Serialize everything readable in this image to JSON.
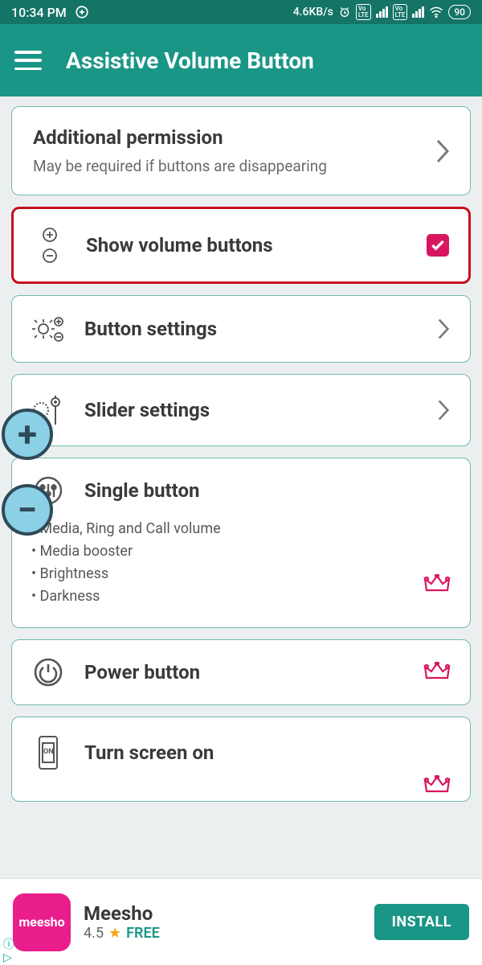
{
  "status": {
    "time": "10:34 PM",
    "speed": "4.6KB/s",
    "battery": "90"
  },
  "appbar": {
    "title": "Assistive Volume Button"
  },
  "cards": {
    "additional": {
      "title": "Additional permission",
      "sub": "May be required if buttons are disappearing"
    },
    "show": {
      "title": "Show volume buttons"
    },
    "button_settings": {
      "title": "Button settings"
    },
    "slider_settings": {
      "title": "Slider settings"
    },
    "single": {
      "title": "Single button",
      "b1": "Media, Ring and Call volume",
      "b2": "Media booster",
      "b3": "Brightness",
      "b4": "Darkness"
    },
    "power": {
      "title": "Power button"
    },
    "screen_on": {
      "title": "Turn screen on"
    }
  },
  "ad": {
    "brand": "meesho",
    "title": "Meesho",
    "rating": "4.5",
    "free": "FREE",
    "cta": "INSTALL"
  }
}
